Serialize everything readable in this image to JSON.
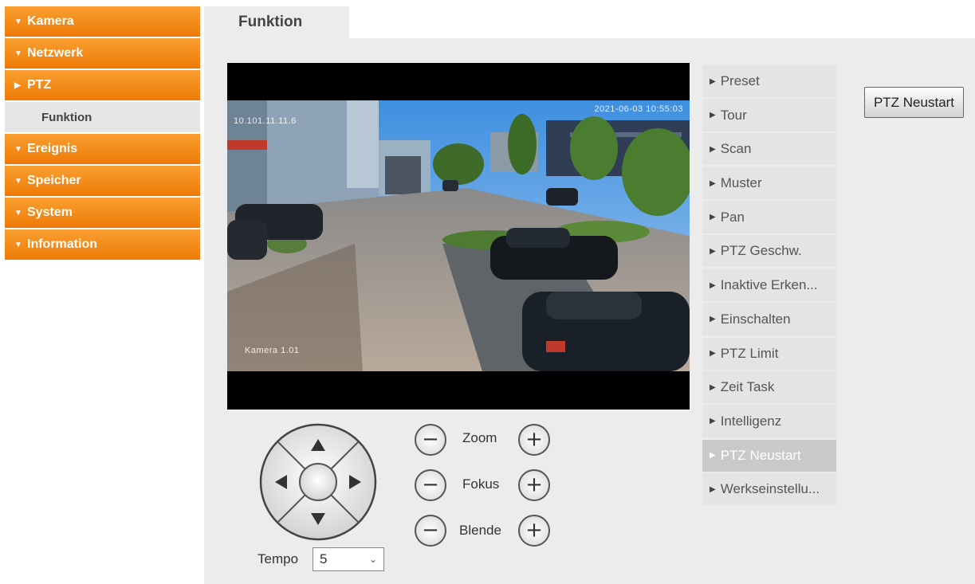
{
  "nav": {
    "items": [
      {
        "label": "Kamera",
        "arrow": "▼"
      },
      {
        "label": "Netzwerk",
        "arrow": "▼"
      },
      {
        "label": "PTZ",
        "arrow": "▶"
      },
      {
        "label": "Funktion",
        "sub": true
      },
      {
        "label": "Ereignis",
        "arrow": "▼"
      },
      {
        "label": "Speicher",
        "arrow": "▼"
      },
      {
        "label": "System",
        "arrow": "▼"
      },
      {
        "label": "Information",
        "arrow": "▼"
      }
    ]
  },
  "tab": {
    "title": "Funktion"
  },
  "video": {
    "osd_ip": "10.101.11.11.6",
    "osd_datetime": "2021-06-03 10:55:03",
    "osd_camera": "Kamera 1.01"
  },
  "controls": {
    "zoom_label": "Zoom",
    "focus_label": "Fokus",
    "iris_label": "Blende",
    "minus_symbol": "−",
    "plus_symbol": "+",
    "tempo_label": "Tempo",
    "tempo_value": "5",
    "tempo_chevron": "⌄"
  },
  "menu": {
    "items": [
      {
        "label": "Preset"
      },
      {
        "label": "Tour"
      },
      {
        "label": "Scan"
      },
      {
        "label": "Muster"
      },
      {
        "label": "Pan"
      },
      {
        "label": "PTZ Geschw."
      },
      {
        "label": "Inaktive Erken..."
      },
      {
        "label": "Einschalten"
      },
      {
        "label": "PTZ Limit"
      },
      {
        "label": "Zeit Task"
      },
      {
        "label": "Intelligenz"
      },
      {
        "label": "PTZ Neustart",
        "active": true
      },
      {
        "label": "Werkseinstellu..."
      }
    ],
    "triangle": "▶"
  },
  "action": {
    "neustart_label": "PTZ Neustart"
  },
  "colors": {
    "nav_orange": "#f08a10",
    "panel_bg": "#ececec",
    "active_menu": "#c9c9c9"
  }
}
